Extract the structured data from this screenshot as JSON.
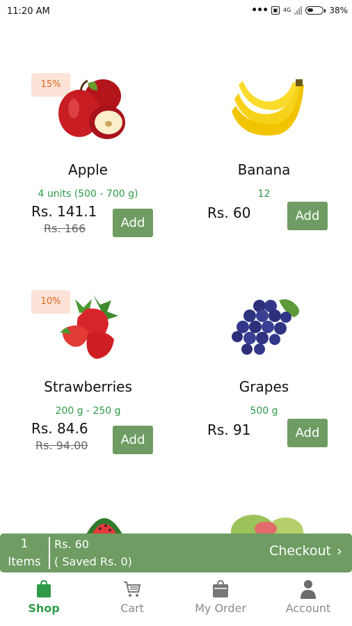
{
  "status_bar": {
    "time": "11:20 AM",
    "network_type": "4G",
    "battery": "38%"
  },
  "products": [
    {
      "name": "Apple",
      "discount_badge": "15%",
      "unit": "4 units (500 - 700 g)",
      "price": "Rs. 141.1",
      "old_price": "Rs. 166",
      "add_label": "Add"
    },
    {
      "name": "Banana",
      "discount_badge": "",
      "unit": "12",
      "price": "Rs. 60",
      "old_price": "",
      "add_label": "Add"
    },
    {
      "name": "Strawberries",
      "discount_badge": "10%",
      "unit": "200 g - 250 g",
      "price": "Rs. 84.6",
      "old_price": "Rs. 94.00",
      "add_label": "Add"
    },
    {
      "name": "Grapes",
      "discount_badge": "",
      "unit": "500 g",
      "price": "Rs. 91",
      "old_price": "",
      "add_label": "Add"
    }
  ],
  "cart_summary": {
    "count": "1",
    "count_label": "Items",
    "total": "Rs. 60",
    "saved": "( Saved Rs. 0)",
    "checkout_label": "Checkout"
  },
  "bottom_nav": [
    {
      "label": "Shop",
      "icon": "bag-icon",
      "active": true
    },
    {
      "label": "Cart",
      "icon": "cart-icon",
      "active": false
    },
    {
      "label": "My Order",
      "icon": "order-bag-icon",
      "active": false
    },
    {
      "label": "Account",
      "icon": "person-icon",
      "active": false
    }
  ],
  "colors": {
    "accent_green": "#6e9c62",
    "text_green": "#2e9a48",
    "badge_bg": "#fbe3d8",
    "badge_text": "#e0641a"
  }
}
